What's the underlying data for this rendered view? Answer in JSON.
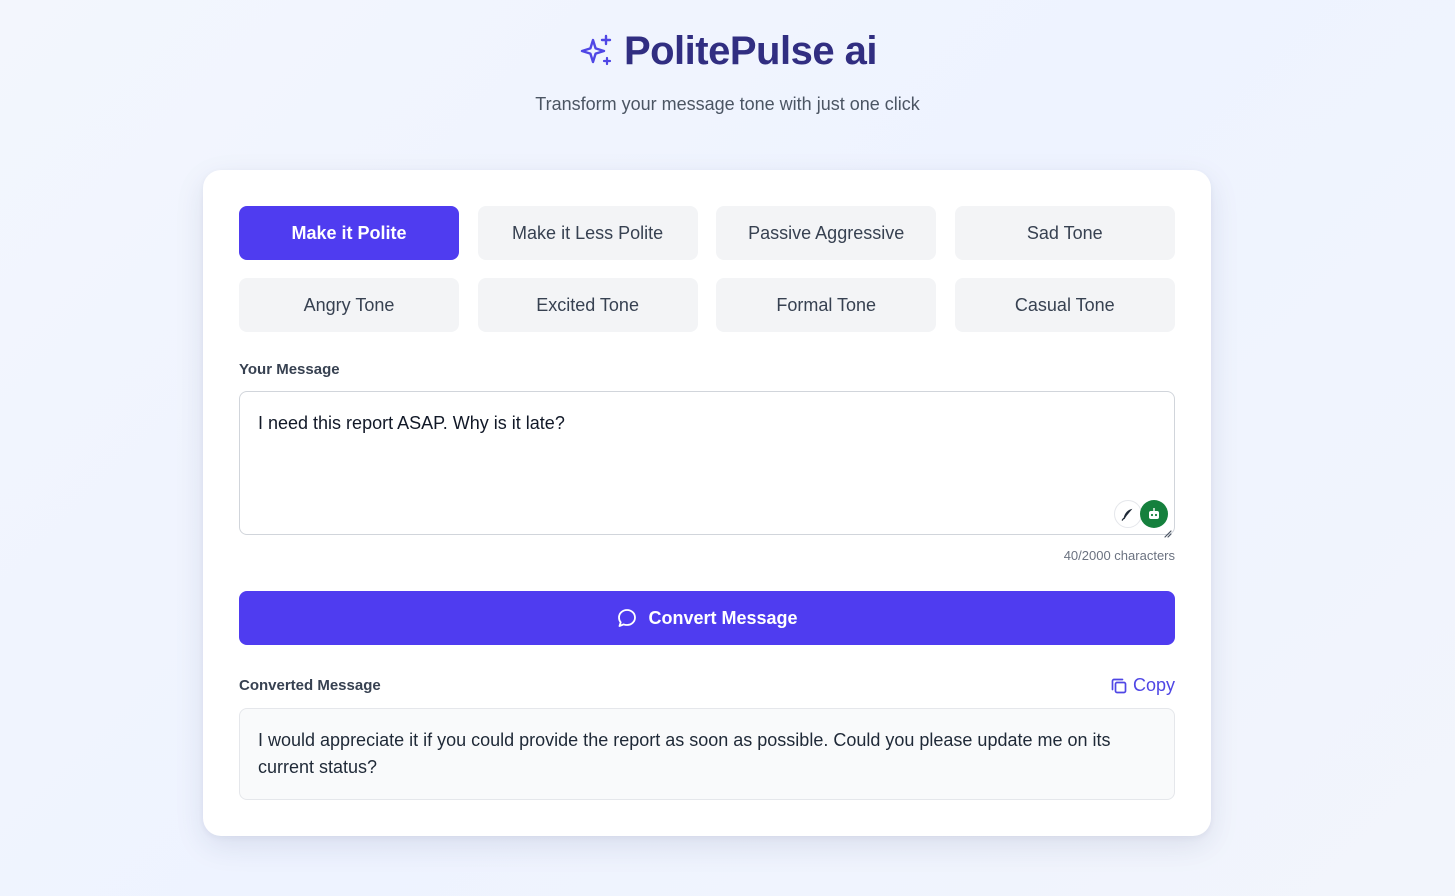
{
  "header": {
    "title": "PolitePulse ai",
    "subtitle": "Transform your message tone with just one click",
    "icon": "sparkles-icon"
  },
  "tones": [
    {
      "label": "Make it Polite",
      "active": true
    },
    {
      "label": "Make it Less Polite",
      "active": false
    },
    {
      "label": "Passive Aggressive",
      "active": false
    },
    {
      "label": "Sad Tone",
      "active": false
    },
    {
      "label": "Angry Tone",
      "active": false
    },
    {
      "label": "Excited Tone",
      "active": false
    },
    {
      "label": "Formal Tone",
      "active": false
    },
    {
      "label": "Casual Tone",
      "active": false
    }
  ],
  "input": {
    "label": "Your Message",
    "value": "I need this report ASAP. Why is it late?",
    "char_count": "40/2000 characters"
  },
  "convert": {
    "label": "Convert Message",
    "icon": "chat-bubble-icon"
  },
  "output": {
    "label": "Converted Message",
    "copy_label": "Copy",
    "value": "I would appreciate it if you could provide the report as soon as possible. Could you please update me on its current status?"
  },
  "colors": {
    "accent": "#4f3cf0",
    "title": "#312e81",
    "background": "#eef3ff"
  }
}
